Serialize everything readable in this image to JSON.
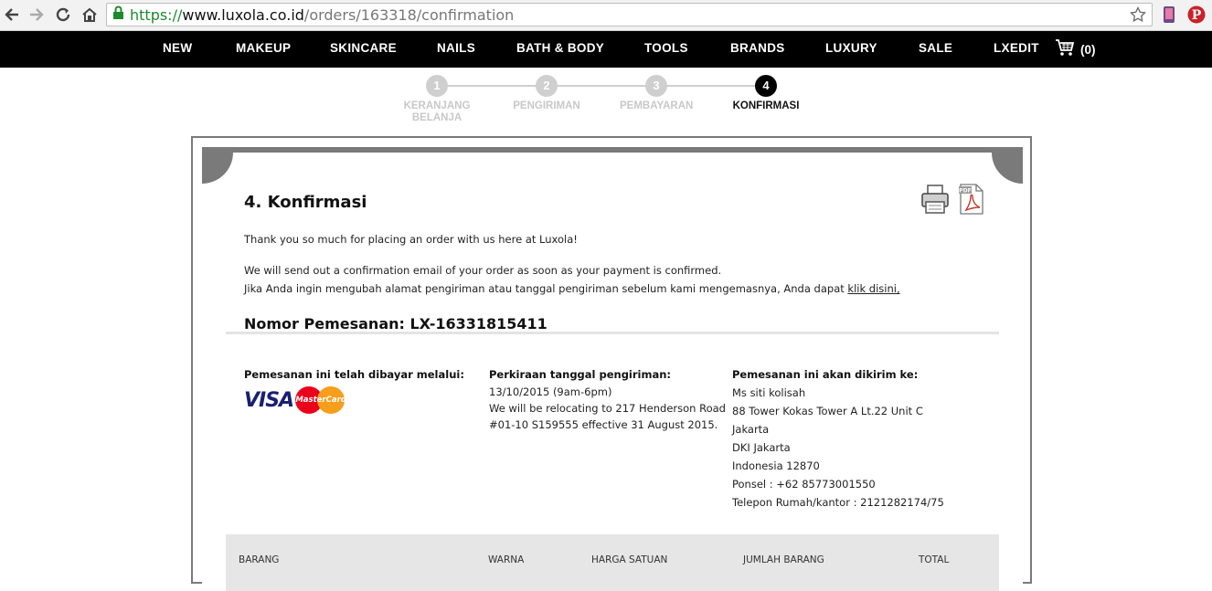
{
  "browser": {
    "url_scheme": "https://",
    "url_host": "www.luxola.co.id",
    "url_path": "/orders/163318/confirmation",
    "icons": [
      "back-arrow-icon",
      "forward-arrow-icon",
      "reload-icon",
      "home-icon",
      "lock-icon",
      "star-icon",
      "phone-extension-icon",
      "pinterest-icon"
    ]
  },
  "nav": {
    "items": [
      "NEW",
      "MAKEUP",
      "SKINCARE",
      "NAILS",
      "BATH & BODY",
      "TOOLS",
      "BRANDS",
      "LUXURY",
      "SALE",
      "LXEDIT"
    ],
    "cart_count": "(0)"
  },
  "steps": [
    {
      "num": "1",
      "label": "KERANJANG\nBELANJA"
    },
    {
      "num": "2",
      "label": "PENGIRIMAN"
    },
    {
      "num": "3",
      "label": "PEMBAYARAN"
    },
    {
      "num": "4",
      "label": "KONFIRMASI"
    }
  ],
  "confirmation": {
    "title": "4. Konfirmasi",
    "thanks": "Thank you so much for placing an order with us here at Luxola!",
    "email_note": "We will send out a confirmation email of your order as soon as your payment is confirmed.",
    "change_note": "Jika Anda ingin mengubah alamat pengiriman atau tanggal pengiriman sebelum kami mengemasnya, Anda dapat ",
    "change_link": "klik disini,",
    "order_number": "Nomor Pemesanan: LX-16331815411",
    "paid_heading": "Pemesanan ini telah dibayar melalui:",
    "visa": "VISA",
    "mastercard": "MasterCard",
    "delivery_heading": "Perkiraan tanggal pengiriman:",
    "delivery_lines": [
      "13/10/2015 (9am-6pm)",
      "We will be relocating to 217 Henderson Road",
      "#01-10 S159555 effective 31 August 2015."
    ],
    "ship_heading": "Pemesanan ini akan dikirim ke:",
    "ship_lines": [
      "Ms siti kolisah",
      "88 Tower Kokas Tower A Lt.22 Unit C",
      "Jakarta",
      "DKI Jakarta",
      "Indonesia 12870",
      "Ponsel : +62 85773001550",
      "Telepon Rumah/kantor : 2121282174/75"
    ]
  },
  "table": {
    "headers": [
      "BARANG",
      "WARNA",
      "HARGA SATUAN",
      "JUMLAH BARANG",
      "TOTAL"
    ]
  }
}
